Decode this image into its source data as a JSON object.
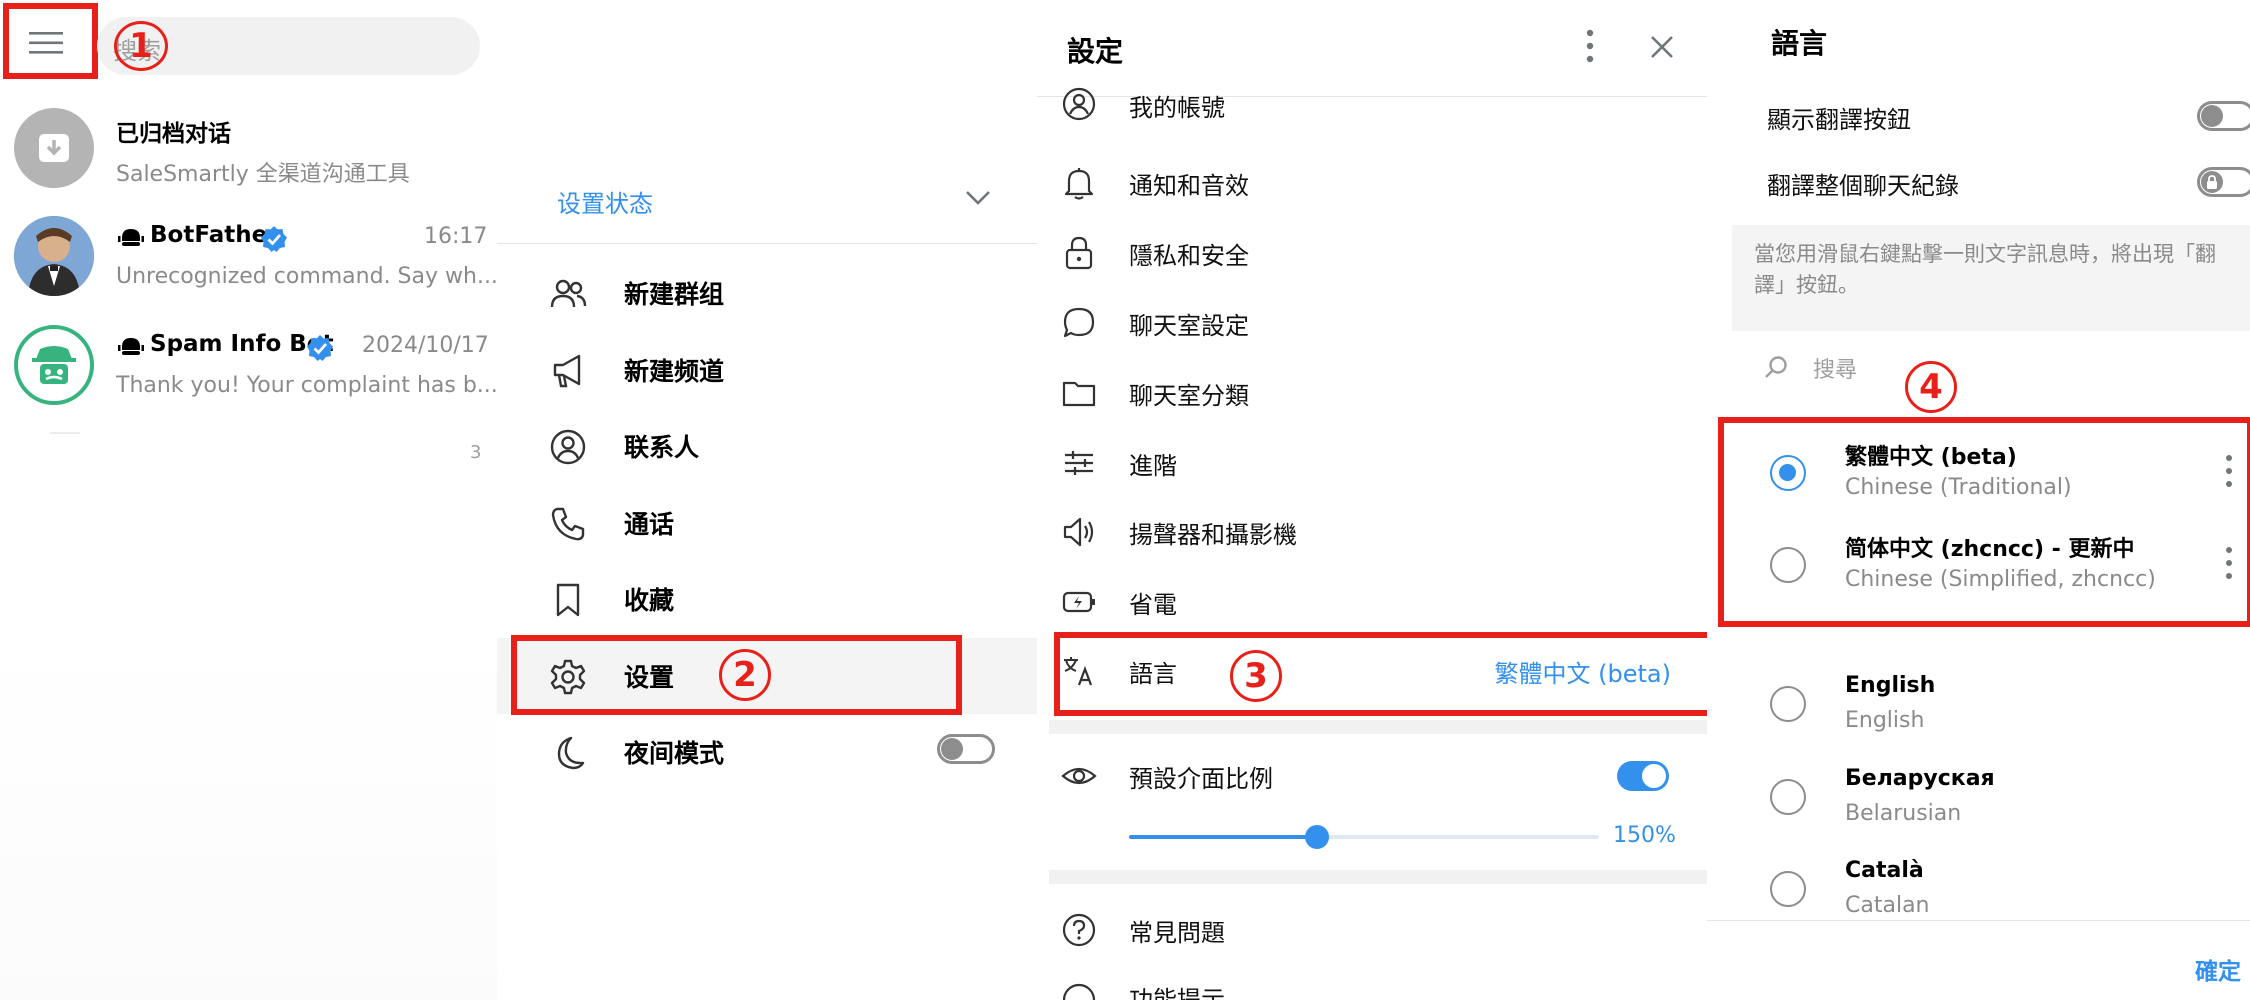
{
  "colors": {
    "accent": "#3390ec",
    "annotation": "#e8201a",
    "muted": "#8a8a8a",
    "verified": "#3390ec"
  },
  "annotations": [
    "1",
    "2",
    "3",
    "4"
  ],
  "chat_list": {
    "search_placeholder": "搜索",
    "chats": [
      {
        "avatar_icon": "archive-icon",
        "name": "已归档对话",
        "preview": "SaleSmartly 全渠道沟通工具",
        "time": ""
      },
      {
        "avatar_icon": "bot-avatar-butler",
        "name": "BotFather",
        "preview": "Unrecognized command. Say wh...",
        "time": "16:17",
        "bot_icon": "bot-icon",
        "verified": true
      },
      {
        "avatar_icon": "bot-avatar-spy",
        "name": "Spam Info Bot",
        "preview": "Thank you! Your complaint has b...",
        "time": "2024/10/17",
        "bot_icon": "bot-icon",
        "verified": true
      }
    ],
    "stray_char": "3"
  },
  "main_menu": {
    "status_label": "设置状态",
    "items": [
      {
        "icon": "new-group-icon",
        "label": "新建群组"
      },
      {
        "icon": "megaphone-icon",
        "label": "新建频道"
      },
      {
        "icon": "contacts-icon",
        "label": "联系人"
      },
      {
        "icon": "phone-icon",
        "label": "通话"
      },
      {
        "icon": "bookmark-icon",
        "label": "收藏"
      },
      {
        "icon": "gear-icon",
        "label": "设置"
      },
      {
        "icon": "moon-icon",
        "label": "夜间模式"
      }
    ]
  },
  "settings": {
    "title": "設定",
    "items": [
      {
        "icon": "account-icon",
        "label": "我的帳號"
      },
      {
        "icon": "bell-icon",
        "label": "通知和音效"
      },
      {
        "icon": "lock-icon",
        "label": "隱私和安全"
      },
      {
        "icon": "chat-bubble-icon",
        "label": "聊天室設定"
      },
      {
        "icon": "folder-icon",
        "label": "聊天室分類"
      },
      {
        "icon": "sliders-icon",
        "label": "進階"
      },
      {
        "icon": "speaker-icon",
        "label": "揚聲器和攝影機"
      },
      {
        "icon": "battery-icon",
        "label": "省電"
      }
    ],
    "language": {
      "icon": "translate-icon",
      "label": "語言",
      "value": "繁體中文 (beta)"
    },
    "scale": {
      "icon": "eye-icon",
      "label": "預設介面比例",
      "enabled": true,
      "value_text": "150%",
      "slider_fraction": 0.4
    },
    "faq": {
      "icon": "question-icon",
      "label": "常見問題"
    },
    "tips": {
      "label": "功能提示"
    }
  },
  "language": {
    "title": "語言",
    "show_translate_label": "顯示翻譯按鈕",
    "translate_chat_label": "翻譯整個聊天紀錄",
    "info_text": "當您用滑鼠右鍵點擊一則文字訊息時，將出現「翻譯」按鈕。",
    "search_placeholder": "搜尋",
    "languages": [
      {
        "name": "繁體中文 (beta)",
        "sub": "Chinese (Traditional)",
        "selected": true
      },
      {
        "name": "简体中文 (zhcncc) - 更新中",
        "sub": "Chinese (Simplified, zhcncc)",
        "selected": false
      },
      {
        "name": "English",
        "sub": "English",
        "selected": false
      },
      {
        "name": "Беларуская",
        "sub": "Belarusian",
        "selected": false
      },
      {
        "name": "Català",
        "sub": "Catalan",
        "selected": false
      }
    ],
    "confirm_label": "確定"
  }
}
